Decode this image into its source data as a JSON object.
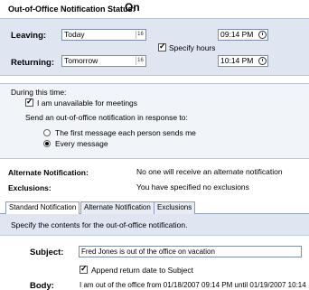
{
  "status": {
    "label": "Out-of-Office Notification Status:",
    "value": "On"
  },
  "leaving": {
    "label": "Leaving:",
    "date": "Today",
    "time": "09:14 PM"
  },
  "returning": {
    "label": "Returning:",
    "date": "Tomorrow",
    "time": "10:14 PM"
  },
  "specify_hours": {
    "label": "Specify hours",
    "checked": true
  },
  "during": {
    "heading": "During this time:",
    "unavailable_label": "I am unavailable for meetings",
    "send_label": "Send an out-of-office notification in response to:",
    "options": [
      "The first message each person sends me",
      "Every message"
    ],
    "selected": 1
  },
  "alternate": {
    "label": "Alternate Notification:",
    "value": "No one will receive an alternate notification",
    "exclusions_label": "Exclusions:",
    "exclusions_value": "You have specified no exclusions"
  },
  "tabs": [
    "Standard Notification",
    "Alternate Notification",
    "Exclusions"
  ],
  "tab_description": "Specify the contents for the out-of-office notification.",
  "subject": {
    "label": "Subject:",
    "value": "Fred Jones is out of the office on vacation"
  },
  "append_label": "Append return date to Subject",
  "body": {
    "label": "Body:",
    "value": "I am out of the office from 01/18/2007 09:14 PM until 01/19/2007 10:14"
  },
  "icons": {
    "calendar": "calendar-icon",
    "clock": "clock-icon",
    "calendar_glyph": "16"
  }
}
